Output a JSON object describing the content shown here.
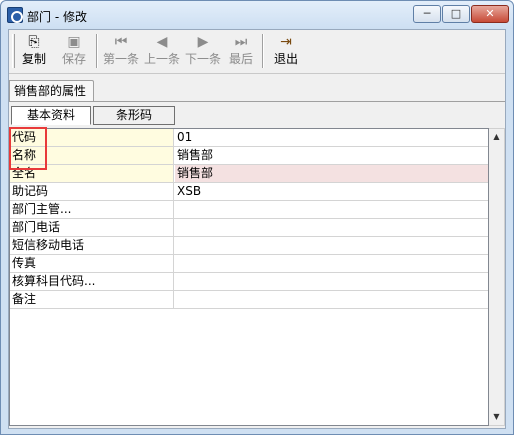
{
  "window": {
    "title": "部门 - 修改",
    "min_glyph": "─",
    "max_glyph": "□",
    "close_glyph": "✕"
  },
  "toolbar": {
    "buttons": [
      {
        "label": "复制",
        "icon": "copy-icon",
        "glyph": "⎘",
        "enabled": true
      },
      {
        "label": "保存",
        "icon": "save-icon",
        "glyph": "▣",
        "enabled": false
      },
      {
        "label": "第一条",
        "icon": "first-record-icon",
        "glyph": "⏮",
        "enabled": false
      },
      {
        "label": "上一条",
        "icon": "previous-record-icon",
        "glyph": "◀",
        "enabled": false
      },
      {
        "label": "下一条",
        "icon": "next-record-icon",
        "glyph": "▶",
        "enabled": false
      },
      {
        "label": "最后",
        "icon": "last-record-icon",
        "glyph": "⏭",
        "enabled": false
      },
      {
        "label": "退出",
        "icon": "exit-door-icon",
        "glyph": "⇥",
        "enabled": true
      }
    ]
  },
  "group_tab": "销售部的属性",
  "subtabs": [
    "基本资料",
    "条形码"
  ],
  "properties": [
    {
      "label": "代码",
      "value": "01"
    },
    {
      "label": "名称",
      "value": "销售部"
    },
    {
      "label": "全名",
      "value": "销售部"
    },
    {
      "label": "助记码",
      "value": "XSB"
    },
    {
      "label": "部门主管...",
      "value": ""
    },
    {
      "label": "部门电话",
      "value": ""
    },
    {
      "label": "短信移动电话",
      "value": ""
    },
    {
      "label": "传真",
      "value": ""
    },
    {
      "label": "核算科目代码...",
      "value": ""
    },
    {
      "label": "备注",
      "value": ""
    }
  ],
  "scroll": {
    "up_glyph": "▲",
    "down_glyph": "▼"
  },
  "colors": {
    "required_label_bg": "#fffce0",
    "selected_value_bg": "#f4e1e1",
    "annotation_box": "#e83a3a"
  }
}
